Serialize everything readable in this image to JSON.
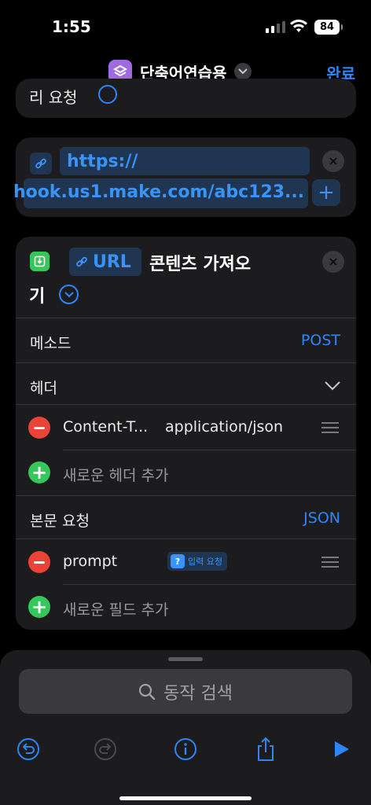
{
  "status": {
    "time": "1:55",
    "battery": "84"
  },
  "nav": {
    "title": "단축어연습용",
    "done": "완료"
  },
  "top_card": {
    "partial_label": "리 요청"
  },
  "url_card": {
    "line1": "https://",
    "line2": "hook.us1.make.com/abc123..."
  },
  "get_card": {
    "token": "URL",
    "title_part1": "콘텐츠 가져오",
    "title_part2": "기",
    "rows": {
      "method_label": "메소드",
      "method_value": "POST",
      "headers_label": "헤더",
      "header_key": "Content-T...",
      "header_value": "application/json",
      "add_header": "새로운 헤더 추가",
      "body_label": "본문 요청",
      "body_value": "JSON",
      "field_key": "prompt",
      "field_value": "입력 요청",
      "add_field": "새로운 필드 추가"
    }
  },
  "sheet": {
    "search_placeholder": "동작 검색"
  },
  "colors": {
    "accent": "#2e86f6",
    "green": "#34c759",
    "red": "#eb4436",
    "purple": "#a06be0"
  }
}
